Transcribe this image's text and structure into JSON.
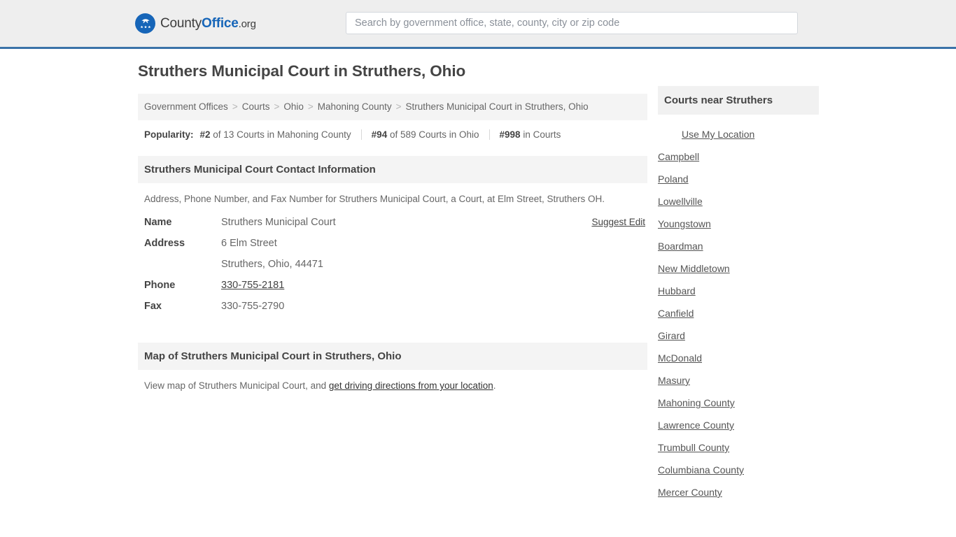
{
  "header": {
    "logo": {
      "icon": "eagle-shield-icon",
      "text_county": "County",
      "text_office": "Office",
      "text_org": ".org"
    },
    "search": {
      "placeholder": "Search by government office, state, county, city or zip code",
      "value": ""
    }
  },
  "main": {
    "page_title": "Struthers Municipal Court in Struthers, Ohio",
    "breadcrumb": {
      "items": [
        "Government Offices",
        "Courts",
        "Ohio",
        "Mahoning County",
        "Struthers Municipal Court in Struthers, Ohio"
      ],
      "separator": ">"
    },
    "popularity": {
      "label": "Popularity:",
      "stats": [
        {
          "rank": "#2",
          "detail": " of 13 Courts in Mahoning County"
        },
        {
          "rank": "#94",
          "detail": " of 589 Courts in Ohio"
        },
        {
          "rank": "#998",
          "detail": " in Courts"
        }
      ]
    },
    "contact_section": {
      "heading": "Struthers Municipal Court Contact Information",
      "description": "Address, Phone Number, and Fax Number for Struthers Municipal Court, a Court, at Elm Street, Struthers OH.",
      "suggest_edit_label": "Suggest Edit",
      "rows": [
        {
          "key": "Name",
          "value": "Struthers Municipal Court",
          "link": false
        },
        {
          "key": "Address",
          "value": "6 Elm Street",
          "link": false
        },
        {
          "key": "",
          "value": "Struthers, Ohio, 44471",
          "link": false
        },
        {
          "key": "Phone",
          "value": "330-755-2181",
          "link": true
        },
        {
          "key": "Fax",
          "value": "330-755-2790",
          "link": false
        }
      ]
    },
    "map_section": {
      "heading": "Map of Struthers Municipal Court in Struthers, Ohio",
      "description_prefix": "View map of Struthers Municipal Court, and ",
      "directions_link": "get driving directions from your location",
      "description_suffix": "."
    }
  },
  "sidebar": {
    "heading": "Courts near Struthers",
    "use_my_location": "Use My Location",
    "links": [
      "Campbell",
      "Poland",
      "Lowellville",
      "Youngstown",
      "Boardman",
      "New Middletown",
      "Hubbard",
      "Canfield",
      "Girard",
      "McDonald",
      "Masury",
      "Mahoning County",
      "Lawrence County",
      "Trumbull County",
      "Columbiana County",
      "Mercer County"
    ]
  },
  "colors": {
    "brand_blue": "#1665b8",
    "header_rule": "#3a72a8",
    "header_bg": "#eeeeee",
    "panel_bg": "#f4f4f4"
  }
}
